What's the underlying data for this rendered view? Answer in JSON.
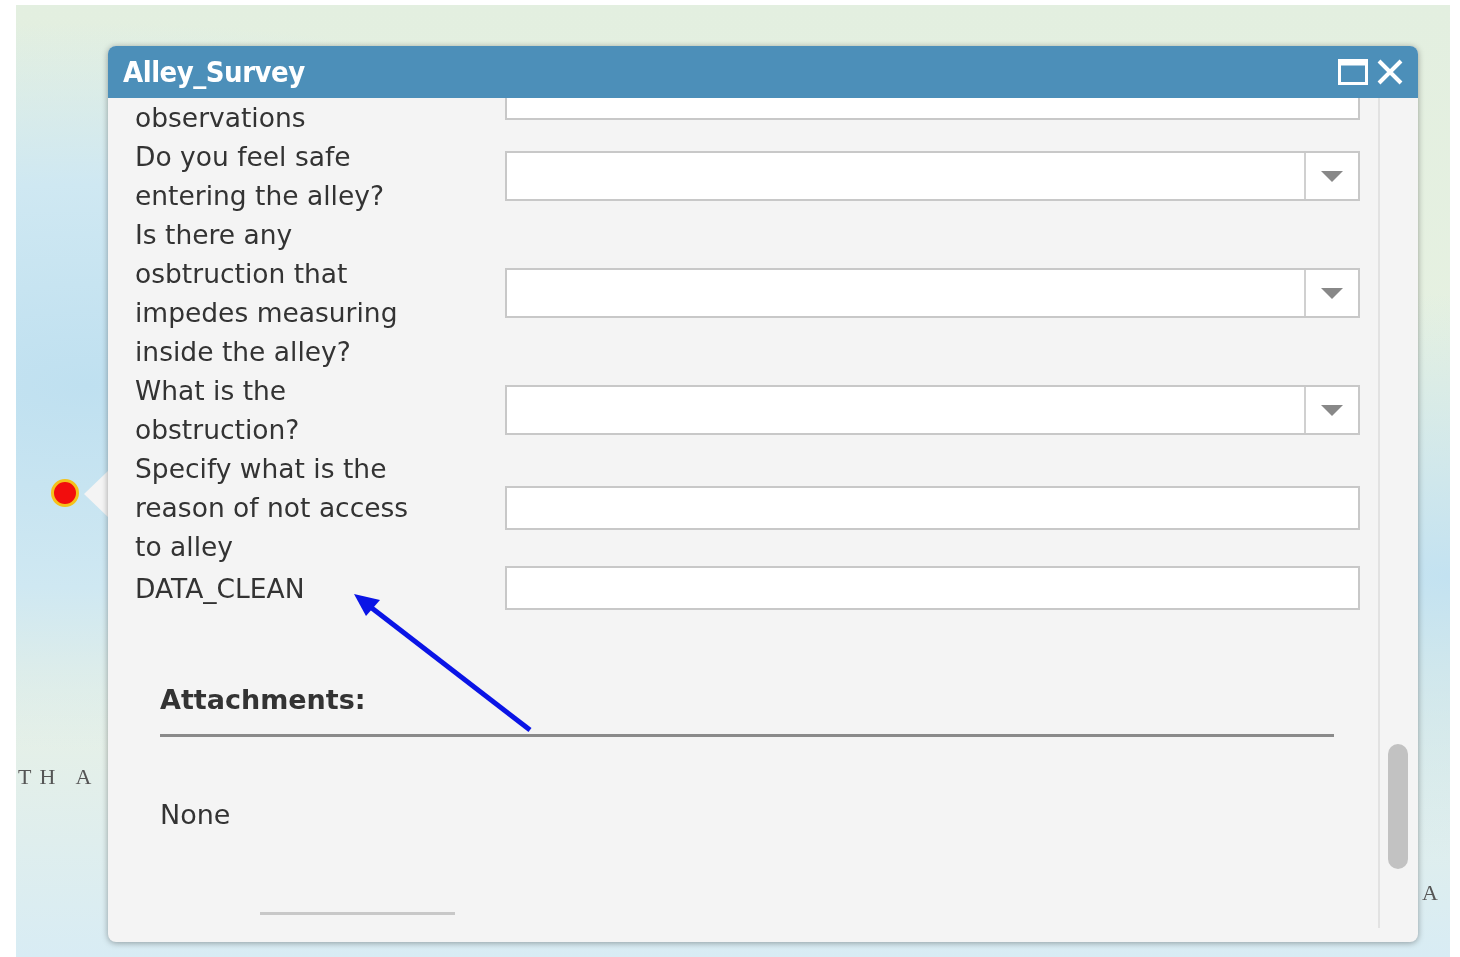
{
  "map": {
    "labels": [
      "TH A",
      "A"
    ]
  },
  "popup": {
    "title": "Alley_Survey",
    "fields": [
      {
        "label": "observations",
        "kind": "text"
      },
      {
        "label": "Do you feel safe entering the alley?",
        "kind": "select"
      },
      {
        "label": "Is there any osbtruction that impedes measuring inside the alley?",
        "kind": "select"
      },
      {
        "label": "What is the obstruction?",
        "kind": "select"
      },
      {
        "label": "Specify what is the reason of not access to alley",
        "kind": "text"
      },
      {
        "label": "DATA_CLEAN",
        "kind": "text"
      }
    ],
    "attachments": {
      "heading": "Attachments:",
      "value": "None"
    }
  }
}
